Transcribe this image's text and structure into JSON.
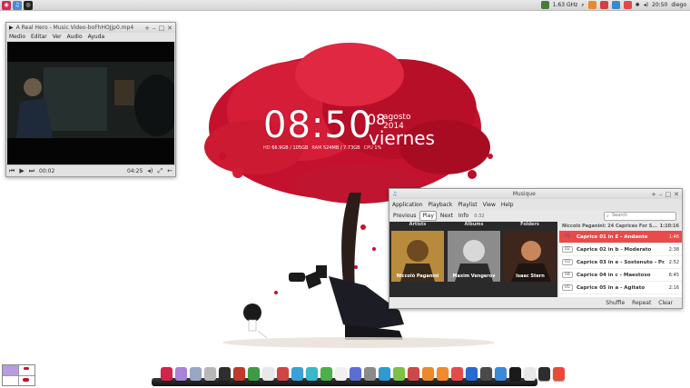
{
  "top_panel": {
    "cpu_freq": "1.63 GHz",
    "time": "20:50",
    "user": "diego"
  },
  "clock": {
    "time": "08:50",
    "day": "08",
    "month_year": "agosto 2014",
    "weekday": "viernes",
    "stats": [
      {
        "key": "HD",
        "value": "66.9GB / 105GB"
      },
      {
        "key": "RAM",
        "value": "524MB / 7.73GB"
      },
      {
        "key": "CPU",
        "value": "1%"
      }
    ]
  },
  "video_player": {
    "title": "A Real Hero - Music Video-boFhHOJjp0.mp4",
    "menu": [
      "Medio",
      "Editar",
      "Ver",
      "Audio",
      "Ayuda"
    ],
    "elapsed": "00:02",
    "total": "04:25"
  },
  "music_player": {
    "title": "Musique",
    "menu": [
      "Application",
      "Playback",
      "Playlist",
      "View",
      "Help"
    ],
    "toolbar": {
      "previous": "Previous",
      "play": "Play",
      "next": "Next",
      "info": "Info",
      "position": "0:32"
    },
    "search_placeholder": "Search",
    "columns": [
      "Artists",
      "Albums",
      "Folders"
    ],
    "artists": [
      "Niccolò Paganini",
      "Maxim Vengerov",
      "Isaac Stern"
    ],
    "playlist_header": {
      "title": "Niccolò Paganini: 24 Caprices For S...",
      "duration": "1:10:16"
    },
    "tracks": [
      {
        "num": "01",
        "title": "Caprice 01 in E - Andante",
        "duration": "1:46",
        "current": true
      },
      {
        "num": "02",
        "title": "Caprice 02 in b - Moderato",
        "duration": "2:38",
        "current": false
      },
      {
        "num": "03",
        "title": "Caprice 03 in e - Sostenuto - Pr...",
        "duration": "2:52",
        "current": false
      },
      {
        "num": "04",
        "title": "Caprice 04 in c - Maestoso",
        "duration": "6:45",
        "current": false
      },
      {
        "num": "05",
        "title": "Caprice 05 in a - Agitato",
        "duration": "2:16",
        "current": false
      }
    ],
    "footer": [
      "Shuffle",
      "Repeat",
      "Clear"
    ]
  },
  "dock": {
    "colors": [
      "#d1244b",
      "#a883d6",
      "#9aa6c4",
      "#b7b7b7",
      "#2e2e2e",
      "#c0392b",
      "#3d9a45",
      "#e8e8e8",
      "#d04545",
      "#3aa0d8",
      "#3ab8c8",
      "#4bb04a",
      "#f0f0f0",
      "#5a6fd0",
      "#8a8a8a",
      "#2e9ad0",
      "#7cc144",
      "#c84a4a",
      "#ea8a2a",
      "#f08a2a",
      "#e54a4a",
      "#2a6ad0",
      "#4a4a4a",
      "#3b8ad8",
      "#1a1a1a",
      "#e8e8e8",
      "#2d2d2d",
      "#e84a3a"
    ]
  }
}
